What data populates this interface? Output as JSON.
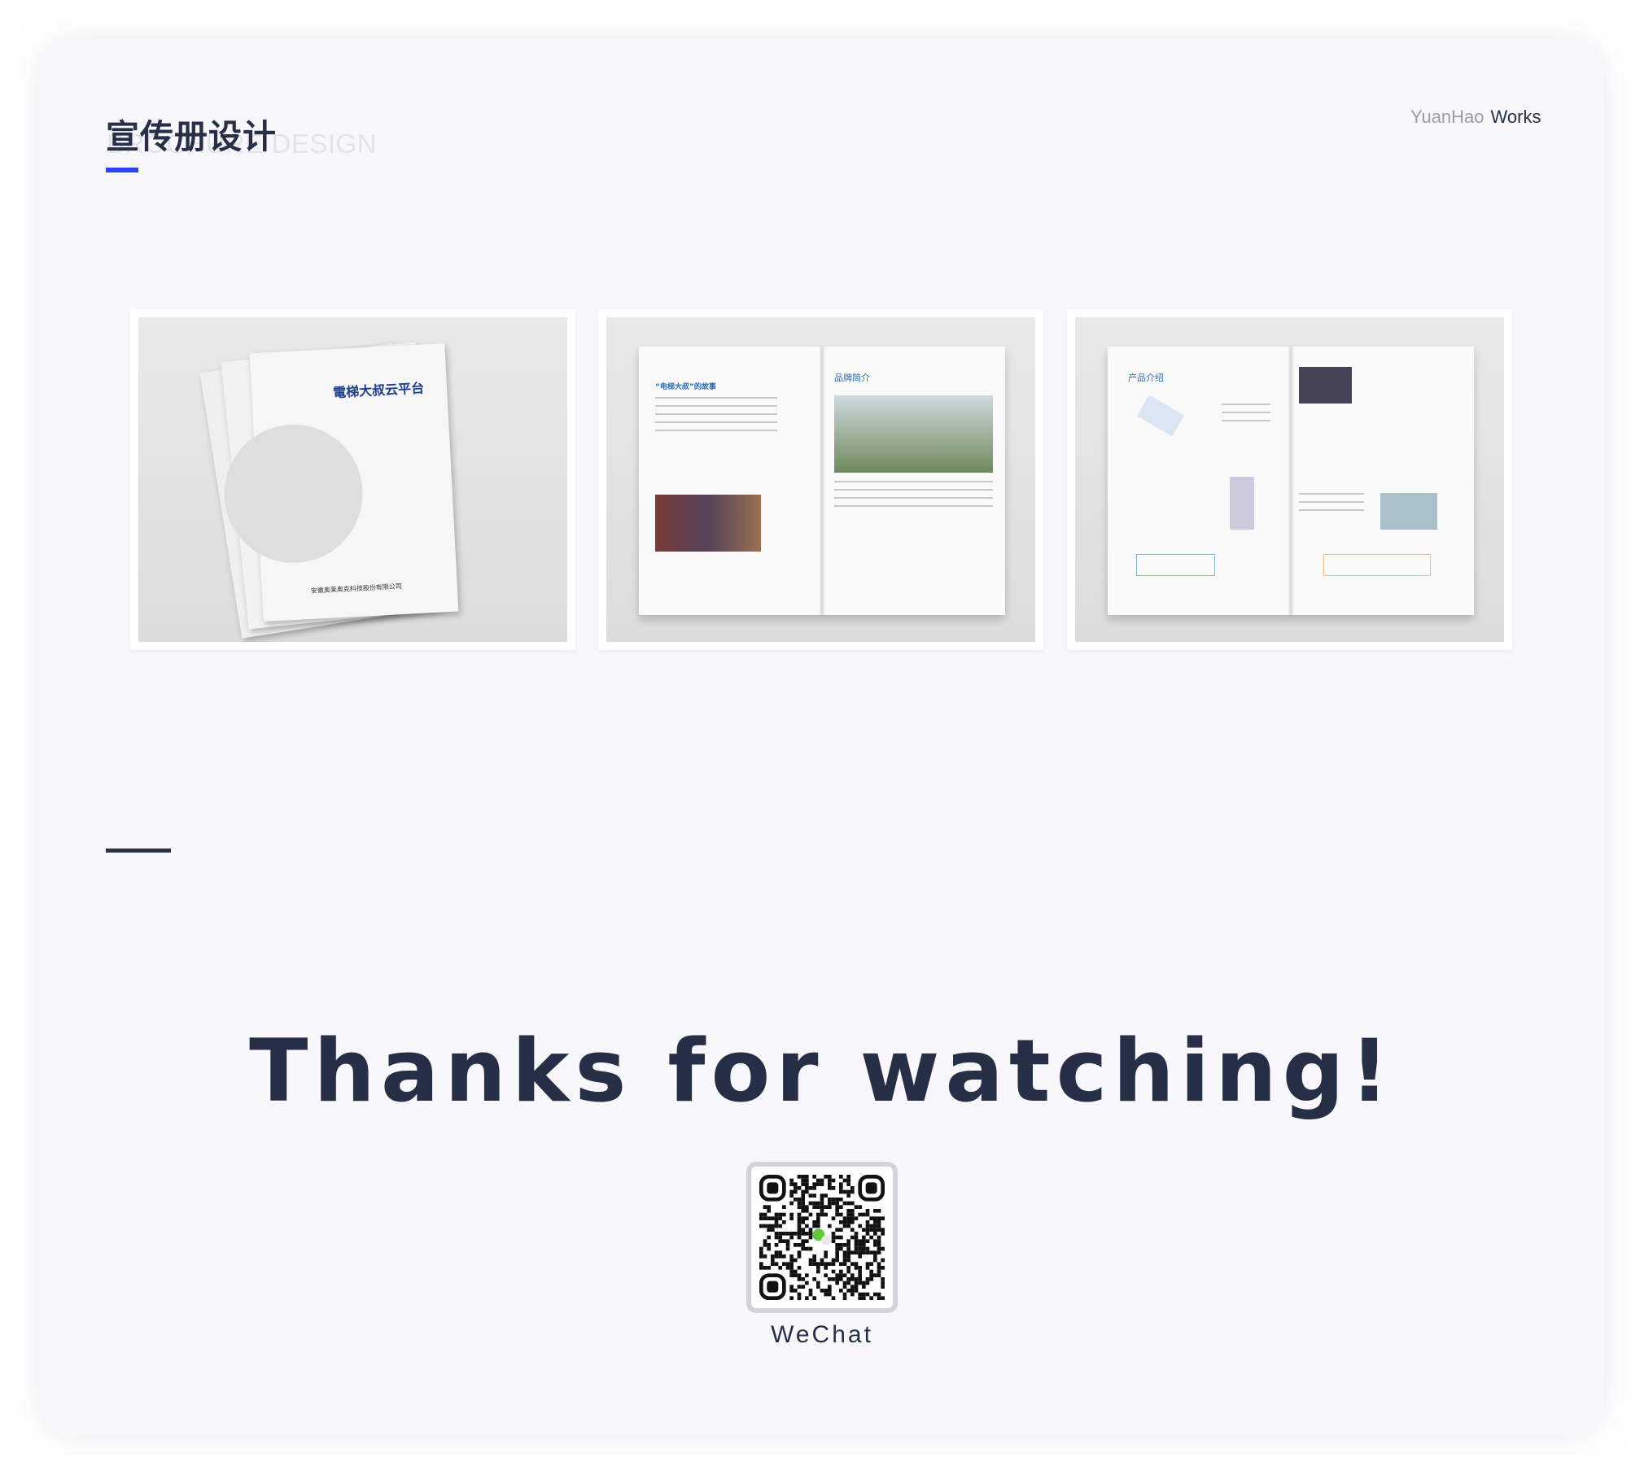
{
  "header": {
    "title": "宣传册设计",
    "subtitle_ghost": "BROCHURE DESIGN",
    "brand_name": "YuanHao",
    "brand_suffix": "Works",
    "accent_color": "#2b45f6"
  },
  "gallery": [
    {
      "label": "brochure-cover",
      "heading": "電梯大叔云平台",
      "company": "安徽奥莱奥克科技股份有限公司"
    },
    {
      "label": "brochure-spread-story",
      "heading": "“电梯大叔”的故事",
      "heading2": "品牌简介"
    },
    {
      "label": "brochure-spread-product",
      "heading": "产品介绍"
    }
  ],
  "footer": {
    "thanks": "Thanks for watching!",
    "qr_label": "WeChat"
  }
}
